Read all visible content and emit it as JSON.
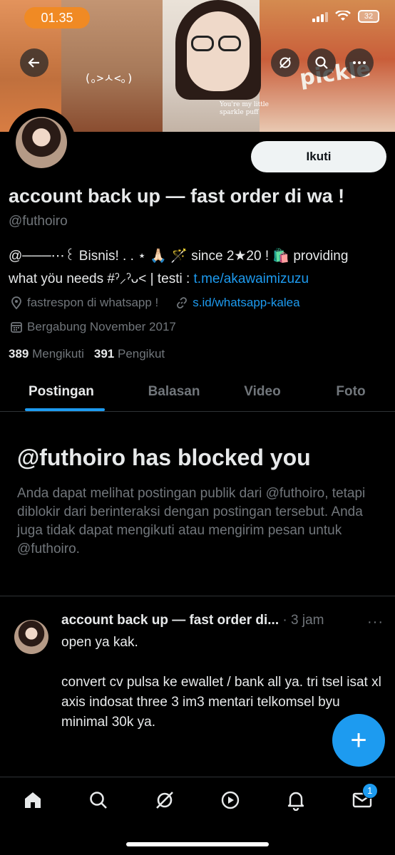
{
  "status_bar": {
    "time": "01.35",
    "battery": "32"
  },
  "banner": {
    "caption_line1": "You're my little",
    "caption_line2": "sparkle puff",
    "deco": "(｡>ㅅ<｡)",
    "sticker_text": "pickle"
  },
  "profile": {
    "follow_label": "Ikuti",
    "display_name": "account back up — fast order di wa !",
    "handle": "@futhoiro",
    "bio_line1": "@───⋯꒰ Bisnis! . . ⋆ 🙏🏻 🪄 since 2★20 ! 🛍️ providing",
    "bio_line2_prefix": "what yöu needs #ˀ⸝ˀᴗ˂ | testi : ",
    "bio_link": "t.me/akawaimizuzu",
    "location": "fastrespon di whatsapp !",
    "website": "s.id/whatsapp-kalea",
    "joined": "Bergabung November 2017",
    "following_count": "389",
    "following_label": "Mengikuti",
    "followers_count": "391",
    "followers_label": "Pengikut"
  },
  "tabs": [
    {
      "label": "Postingan",
      "active": true
    },
    {
      "label": "Balasan",
      "active": false
    },
    {
      "label": "Video",
      "active": false
    },
    {
      "label": "Foto",
      "active": false
    }
  ],
  "blocked": {
    "title": "@futhoiro has blocked you",
    "text": "Anda dapat melihat postingan publik dari @futhoiro, tetapi diblokir dari berinteraksi dengan postingan tersebut. Anda juga tidak dapat mengikuti atau mengirim pesan untuk @futhoiro."
  },
  "post": {
    "author": "account back up — fast order di...",
    "time": "· 3 jam",
    "more": "···",
    "body": "open ya kak.\n\nconvert cv pulsa ke ewallet / bank all ya. tri tsel isat xl axis  indosat three 3 im3 mentari telkomsel byu\nminimal 30k ya."
  },
  "fab": {
    "label": "+"
  },
  "nav": {
    "items": [
      "home-icon",
      "search-icon",
      "grok-icon",
      "video-icon",
      "notifications-icon",
      "messages-icon"
    ],
    "messages_badge": "1"
  },
  "colors": {
    "accent": "#1d9bf0",
    "time_pill": "#f08a24",
    "muted": "#71767b",
    "background": "#000000"
  }
}
